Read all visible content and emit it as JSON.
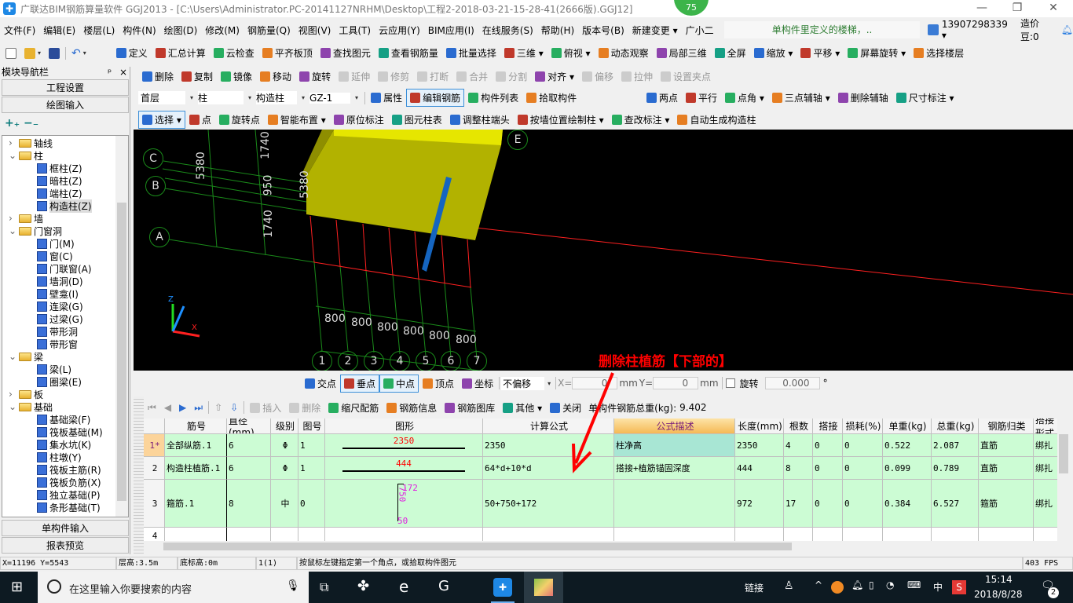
{
  "window": {
    "title": "广联达BIM钢筋算量软件 GGJ2013 - [C:\\Users\\Administrator.PC-20141127NRHM\\Desktop\\工程2-2018-03-21-15-28-41(2666版).GGJ12]",
    "badge": "75",
    "minimize": "—",
    "restore": "❐",
    "close": "✕"
  },
  "menu": [
    "文件(F)",
    "编辑(E)",
    "楼层(L)",
    "构件(N)",
    "绘图(D)",
    "修改(M)",
    "钢筋量(Q)",
    "视图(V)",
    "工具(T)",
    "云应用(Y)",
    "BIM应用(I)",
    "在线服务(S)",
    "帮助(H)",
    "版本号(B)",
    "新建变更 ▾",
    "广小二"
  ],
  "menu_notice": "单构件里定义的楼梯，..",
  "user": {
    "phone": "13907298339 ▾",
    "beans": "造价豆:0"
  },
  "toolbar1": [
    "定义",
    "汇总计算",
    "云检查",
    "平齐板顶",
    "查找图元",
    "查看钢筋量",
    "批量选择",
    "三维 ▾",
    "俯视 ▾",
    "动态观察",
    "局部三维",
    "全屏",
    "缩放 ▾",
    "平移 ▾",
    "屏幕旋转 ▾",
    "选择楼层"
  ],
  "toolbar_edit": [
    {
      "l": "删除"
    },
    {
      "l": "复制"
    },
    {
      "l": "镜像"
    },
    {
      "l": "移动"
    },
    {
      "l": "旋转"
    },
    {
      "l": "延伸",
      "d": true
    },
    {
      "l": "修剪",
      "d": true
    },
    {
      "l": "打断",
      "d": true
    },
    {
      "l": "合并",
      "d": true
    },
    {
      "l": "分割",
      "d": true
    },
    {
      "l": "对齐 ▾"
    },
    {
      "l": "偏移",
      "d": true
    },
    {
      "l": "拉伸",
      "d": true
    },
    {
      "l": "设置夹点",
      "d": true
    }
  ],
  "selectors": {
    "floor": "首层",
    "type": "柱",
    "subtype": "构造柱",
    "name": "GZ-1"
  },
  "toolbar_comp": [
    {
      "l": "属性"
    },
    {
      "l": "编辑钢筋",
      "a": true
    },
    {
      "l": "构件列表"
    },
    {
      "l": "拾取构件"
    }
  ],
  "toolbar_axis": [
    "两点",
    "平行",
    "点角 ▾",
    "三点辅轴 ▾",
    "删除辅轴",
    "尺寸标注 ▾"
  ],
  "toolbar_draw": [
    {
      "l": "选择 ▾",
      "a": true
    },
    {
      "l": "点"
    },
    {
      "l": "旋转点"
    },
    {
      "l": "智能布置 ▾"
    },
    {
      "l": "原位标注"
    },
    {
      "l": "图元柱表"
    },
    {
      "l": "调整柱端头"
    },
    {
      "l": "按墙位置绘制柱 ▾"
    },
    {
      "l": "查改标注 ▾"
    },
    {
      "l": "自动生成构造柱"
    }
  ],
  "nav": {
    "title": "模块导航栏",
    "pin": "ᵖ",
    "close": "×",
    "project_settings": "工程设置",
    "drawing_input": "绘图输入",
    "single_input": "单构件输入",
    "report_preview": "报表预览",
    "expand_all": "+₊",
    "collapse_all": "−₋"
  },
  "tree": [
    {
      "label": "轴线",
      "level": 0,
      "open": false
    },
    {
      "label": "柱",
      "level": 0,
      "open": true
    },
    {
      "label": "框柱(Z)",
      "level": 1
    },
    {
      "label": "暗柱(Z)",
      "level": 1
    },
    {
      "label": "端柱(Z)",
      "level": 1
    },
    {
      "label": "构造柱(Z)",
      "level": 1,
      "selected": true
    },
    {
      "label": "墙",
      "level": 0,
      "open": false
    },
    {
      "label": "门窗洞",
      "level": 0,
      "open": true
    },
    {
      "label": "门(M)",
      "level": 1
    },
    {
      "label": "窗(C)",
      "level": 1
    },
    {
      "label": "门联窗(A)",
      "level": 1
    },
    {
      "label": "墙洞(D)",
      "level": 1
    },
    {
      "label": "壁龛(I)",
      "level": 1
    },
    {
      "label": "连梁(G)",
      "level": 1
    },
    {
      "label": "过梁(G)",
      "level": 1
    },
    {
      "label": "带形洞",
      "level": 1
    },
    {
      "label": "带形窗",
      "level": 1
    },
    {
      "label": "梁",
      "level": 0,
      "open": true
    },
    {
      "label": "梁(L)",
      "level": 1
    },
    {
      "label": "圈梁(E)",
      "level": 1
    },
    {
      "label": "板",
      "level": 0,
      "open": false
    },
    {
      "label": "基础",
      "level": 0,
      "open": true
    },
    {
      "label": "基础梁(F)",
      "level": 1
    },
    {
      "label": "筏板基础(M)",
      "level": 1
    },
    {
      "label": "集水坑(K)",
      "level": 1
    },
    {
      "label": "柱墩(Y)",
      "level": 1
    },
    {
      "label": "筏板主筋(R)",
      "level": 1
    },
    {
      "label": "筏板负筋(X)",
      "level": 1
    },
    {
      "label": "独立基础(P)",
      "level": 1
    },
    {
      "label": "条形基础(T)",
      "level": 1
    }
  ],
  "viewport": {
    "axes_rows": [
      "C",
      "B",
      "A",
      "E"
    ],
    "axes_cols": [
      "1",
      "2",
      "3",
      "4",
      "5",
      "6",
      "7"
    ],
    "dims_col": [
      "800",
      "800",
      "800",
      "800",
      "800",
      "800"
    ],
    "dims_row": [
      "5380",
      "1740",
      "950",
      "1740",
      "5380"
    ],
    "triad": {
      "x": "X",
      "z": "Z"
    },
    "colors": {
      "grid": "#1a8a1a",
      "red": "#ff2020",
      "wall": "#d4d400",
      "column": "#1565c0"
    }
  },
  "snapbar": {
    "items": [
      "交点",
      "垂点",
      "中点",
      "顶点",
      "坐标"
    ],
    "offset_mode": "不偏移",
    "x_label": "X=",
    "x_value": "0",
    "y_label": "Y=",
    "y_value": "0",
    "unit": "mm",
    "rotate_label": "旋转",
    "rotate_value": "0.000",
    "degree": "°"
  },
  "annotation": "删除柱植筋【下部的】",
  "rebar_toolbar": {
    "items": [
      {
        "l": "插入",
        "d": true
      },
      {
        "l": "删除",
        "d": true
      },
      {
        "l": "缩尺配筋"
      },
      {
        "l": "钢筋信息"
      },
      {
        "l": "钢筋图库"
      },
      {
        "l": "其他 ▾"
      },
      {
        "l": "关闭"
      }
    ],
    "total_label": "单构件钢筋总重(kg):",
    "total": "9.402"
  },
  "table": {
    "headers": [
      "",
      "筋号",
      "直径(mm)",
      "级别",
      "图号",
      "图形",
      "计算公式",
      "公式描述",
      "长度(mm)",
      "根数",
      "搭接",
      "损耗(%)",
      "单重(kg)",
      "总重(kg)",
      "钢筋归类",
      "搭接形式"
    ],
    "rows": [
      {
        "no": "1*",
        "name": "全部纵筋.1",
        "dia": "6",
        "grade": "Φ",
        "fig": "1",
        "shape_label": "2350",
        "formula": "2350",
        "desc": "柱净高",
        "len": "2350",
        "count": "4",
        "lap": "0",
        "loss": "0",
        "unit_w": "0.522",
        "total_w": "2.087",
        "cat": "直筋",
        "lap_type": "绑扎"
      },
      {
        "no": "2",
        "name": "构造柱植筋.1",
        "dia": "6",
        "grade": "Φ",
        "fig": "1",
        "shape_label": "444",
        "formula": "64*d+10*d",
        "desc": "搭接+植筋锚固深度",
        "len": "444",
        "count": "8",
        "lap": "0",
        "loss": "0",
        "unit_w": "0.099",
        "total_w": "0.789",
        "cat": "直筋",
        "lap_type": "绑扎"
      },
      {
        "no": "3",
        "name": "箍筋.1",
        "dia": "8",
        "grade": "中",
        "fig": "0",
        "shape_labels": [
          "172",
          "750",
          "50"
        ],
        "formula": "50+750+172",
        "desc": "",
        "len": "972",
        "count": "17",
        "lap": "0",
        "loss": "0",
        "unit_w": "0.384",
        "total_w": "6.527",
        "cat": "箍筋",
        "lap_type": "绑扎"
      },
      {
        "no": "4"
      }
    ]
  },
  "status": {
    "coords": "X=11196 Y=5543",
    "floor_height": "层高:3.5m",
    "base_height": "底标高:0m",
    "count": "1(1)",
    "hint": "按鼠标左键指定第一个角点，或拾取构件图元",
    "fps": "403 FPS"
  },
  "taskbar": {
    "search": "在这里输入你要搜索的内容",
    "links": "链接",
    "ime": "中",
    "time": "15:14",
    "date": "2018/8/28",
    "notifications": "2"
  }
}
